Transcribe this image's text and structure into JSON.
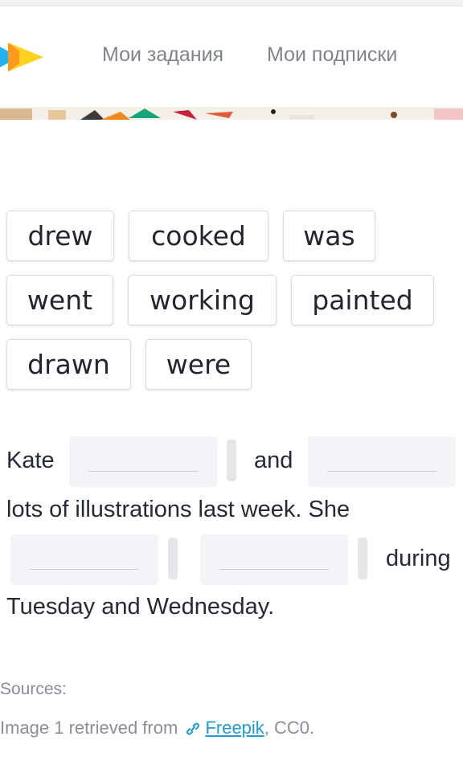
{
  "header": {
    "logo_icon": "brand-play-logo",
    "nav": [
      {
        "label": "Мои задания"
      },
      {
        "label": "Мои подписки"
      }
    ]
  },
  "word_bank": [
    "drew",
    "cooked",
    "was",
    "went",
    "working",
    "painted",
    "drawn",
    "were"
  ],
  "sentence": {
    "line1_start": "Kate",
    "line1_mid": "and",
    "line2": "lots of illustrations last week. She",
    "line3_end": "during",
    "line4": "Tuesday and Wednesday."
  },
  "sources": {
    "label": "Sources:",
    "prefix": "Image 1 retrieved from",
    "link_icon": "link-icon",
    "link_text": "Freepik",
    "suffix": ", CC0."
  },
  "colors": {
    "accent_blue": "#1e9bd7",
    "logo_yellow": "#ffd21f",
    "logo_orange": "#ff9a1f",
    "logo_blue": "#20b3f0",
    "blank_bg": "#f2f4f8"
  }
}
